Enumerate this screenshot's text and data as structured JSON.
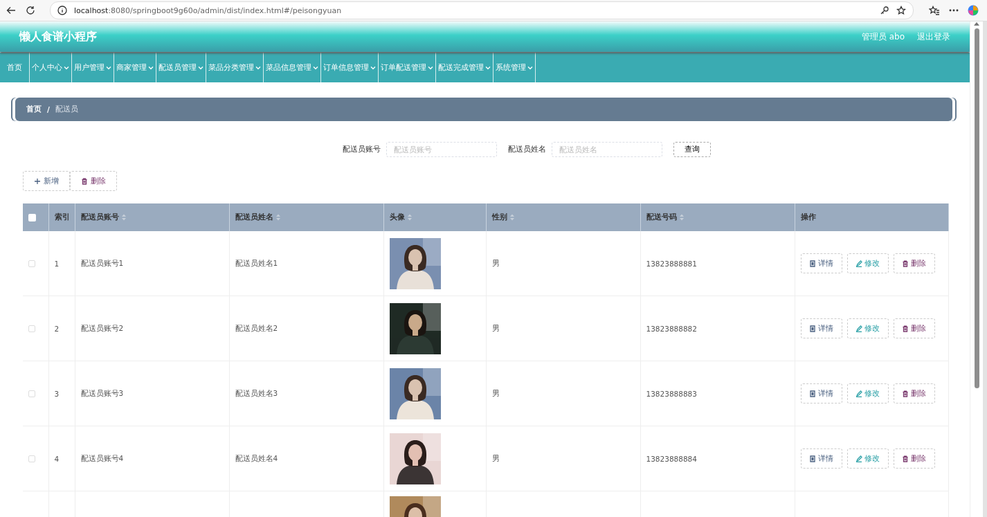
{
  "browser": {
    "address": "**localhost**:8080/springboot9g60o/admin/dist/index.html#/peisongyuan"
  },
  "header": {
    "title": "懒人食谱小程序",
    "user": "管理员 abo",
    "logout": "退出登录"
  },
  "nav": [
    {
      "label": "首页",
      "has_menu": false
    },
    {
      "label": "个人中心",
      "has_menu": true
    },
    {
      "label": "用户管理",
      "has_menu": true
    },
    {
      "label": "商家管理",
      "has_menu": true
    },
    {
      "label": "配送员管理",
      "has_menu": true
    },
    {
      "label": "菜品分类管理",
      "has_menu": true
    },
    {
      "label": "菜品信息管理",
      "has_menu": true
    },
    {
      "label": "订单信息管理",
      "has_menu": true
    },
    {
      "label": "订单配送管理",
      "has_menu": true
    },
    {
      "label": "配送完成管理",
      "has_menu": true
    },
    {
      "label": "系统管理",
      "has_menu": true
    }
  ],
  "breadcrumb": {
    "items": [
      {
        "label": "首页",
        "current": false
      },
      {
        "label": "配送员",
        "current": true
      }
    ],
    "separator": "/"
  },
  "search": {
    "fields": [
      {
        "label": "配送员账号",
        "placeholder": "配送员账号"
      },
      {
        "label": "配送员姓名",
        "placeholder": "配送员姓名"
      }
    ],
    "button": "查询"
  },
  "actions": [
    {
      "kind": "add",
      "label": "新增"
    },
    {
      "kind": "delete",
      "label": "删除"
    }
  ],
  "table": {
    "columns": [
      {
        "kind": "check",
        "checked": false
      },
      {
        "kind": "text",
        "label": "索引",
        "sortable": false
      },
      {
        "kind": "text",
        "label": "配送员账号",
        "sortable": true
      },
      {
        "kind": "text",
        "label": "配送员姓名",
        "sortable": true
      },
      {
        "kind": "text",
        "label": "头像",
        "sortable": true
      },
      {
        "kind": "text",
        "label": "性别",
        "sortable": true
      },
      {
        "kind": "text",
        "label": "配送号码",
        "sortable": true
      },
      {
        "kind": "text",
        "label": "操作",
        "sortable": false
      }
    ],
    "rows": [
      {
        "checked": false,
        "index": "1",
        "account": "配送员账号1",
        "name": "配送员姓名1",
        "avatar": {
          "kind": "picture"
        },
        "gender": "男",
        "phone": "13823888881",
        "buttons": [
          {
            "kind": "detail",
            "label": "详情"
          },
          {
            "kind": "edit",
            "label": "修改"
          },
          {
            "kind": "delete",
            "label": "删除"
          }
        ]
      },
      {
        "checked": false,
        "index": "2",
        "account": "配送员账号2",
        "name": "配送员姓名2",
        "avatar": {
          "kind": "picture"
        },
        "gender": "男",
        "phone": "13823888882",
        "buttons": [
          {
            "kind": "detail",
            "label": "详情"
          },
          {
            "kind": "edit",
            "label": "修改"
          },
          {
            "kind": "delete",
            "label": "删除"
          }
        ]
      },
      {
        "checked": false,
        "index": "3",
        "account": "配送员账号3",
        "name": "配送员姓名3",
        "avatar": {
          "kind": "picture"
        },
        "gender": "男",
        "phone": "13823888883",
        "buttons": [
          {
            "kind": "detail",
            "label": "详情"
          },
          {
            "kind": "edit",
            "label": "修改"
          },
          {
            "kind": "delete",
            "label": "删除"
          }
        ]
      },
      {
        "checked": false,
        "index": "4",
        "account": "配送员账号4",
        "name": "配送员姓名4",
        "avatar": {
          "kind": "picture"
        },
        "gender": "男",
        "phone": "13823888884",
        "buttons": [
          {
            "kind": "detail",
            "label": "详情"
          },
          {
            "kind": "edit",
            "label": "修改"
          },
          {
            "kind": "delete",
            "label": "删除"
          }
        ]
      },
      {
        "avatar": {
          "kind": "picture"
        }
      }
    ]
  }
}
